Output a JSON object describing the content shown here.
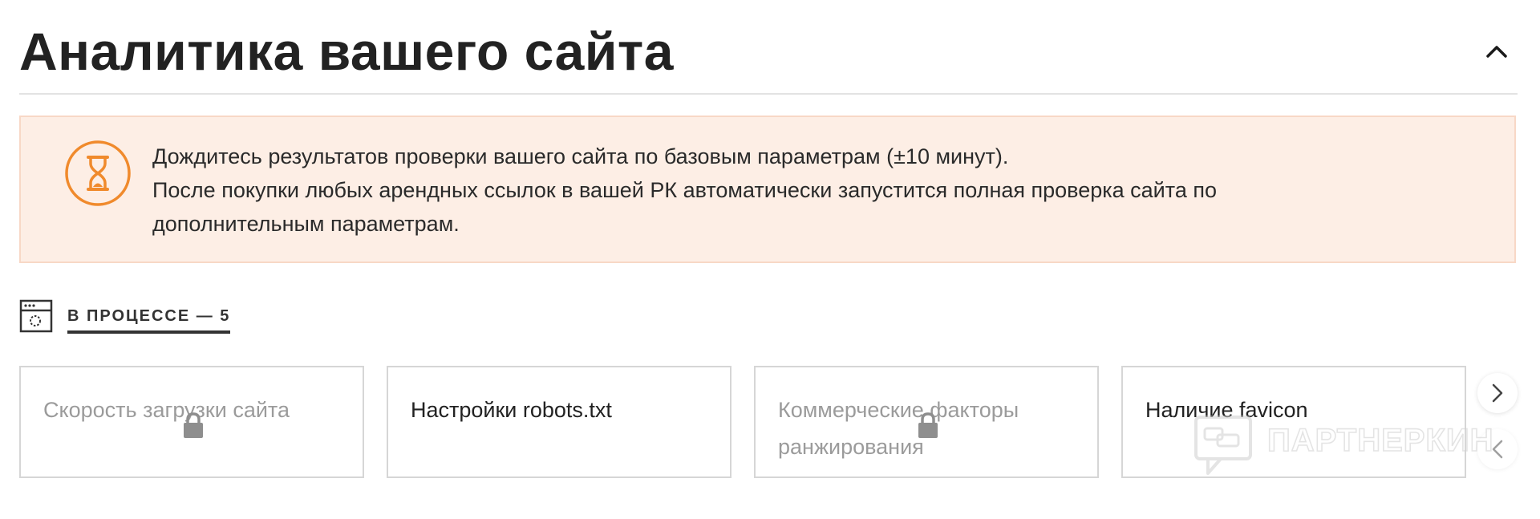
{
  "header": {
    "title": "Аналитика вашего сайта",
    "collapse_icon": "chevron-up-icon"
  },
  "notice": {
    "icon": "hourglass-icon",
    "accent_color": "#f08a2c",
    "background_color": "#fdeee5",
    "lines": [
      "Дождитесь результатов проверки вашего сайта по базовым параметрам (±10 минут).",
      "После покупки любых арендных ссылок в вашей РК автоматически запустится полная проверка сайта по",
      "дополнительным параметрам."
    ]
  },
  "status_tab": {
    "icon": "browser-loading-icon",
    "label": "В ПРОЦЕССЕ — 5"
  },
  "cards": [
    {
      "title": "Скорость загрузки сайта",
      "locked": true
    },
    {
      "title": "Настройки robots.txt",
      "locked": false
    },
    {
      "title": "Коммерческие факторы ранжирования",
      "locked": true
    },
    {
      "title": "Наличие favicon",
      "locked": false
    }
  ],
  "carousel": {
    "next_icon": "chevron-right-icon",
    "prev_icon": "chevron-left-icon"
  },
  "watermark": {
    "text": "ПАРТНЕРКИН"
  }
}
